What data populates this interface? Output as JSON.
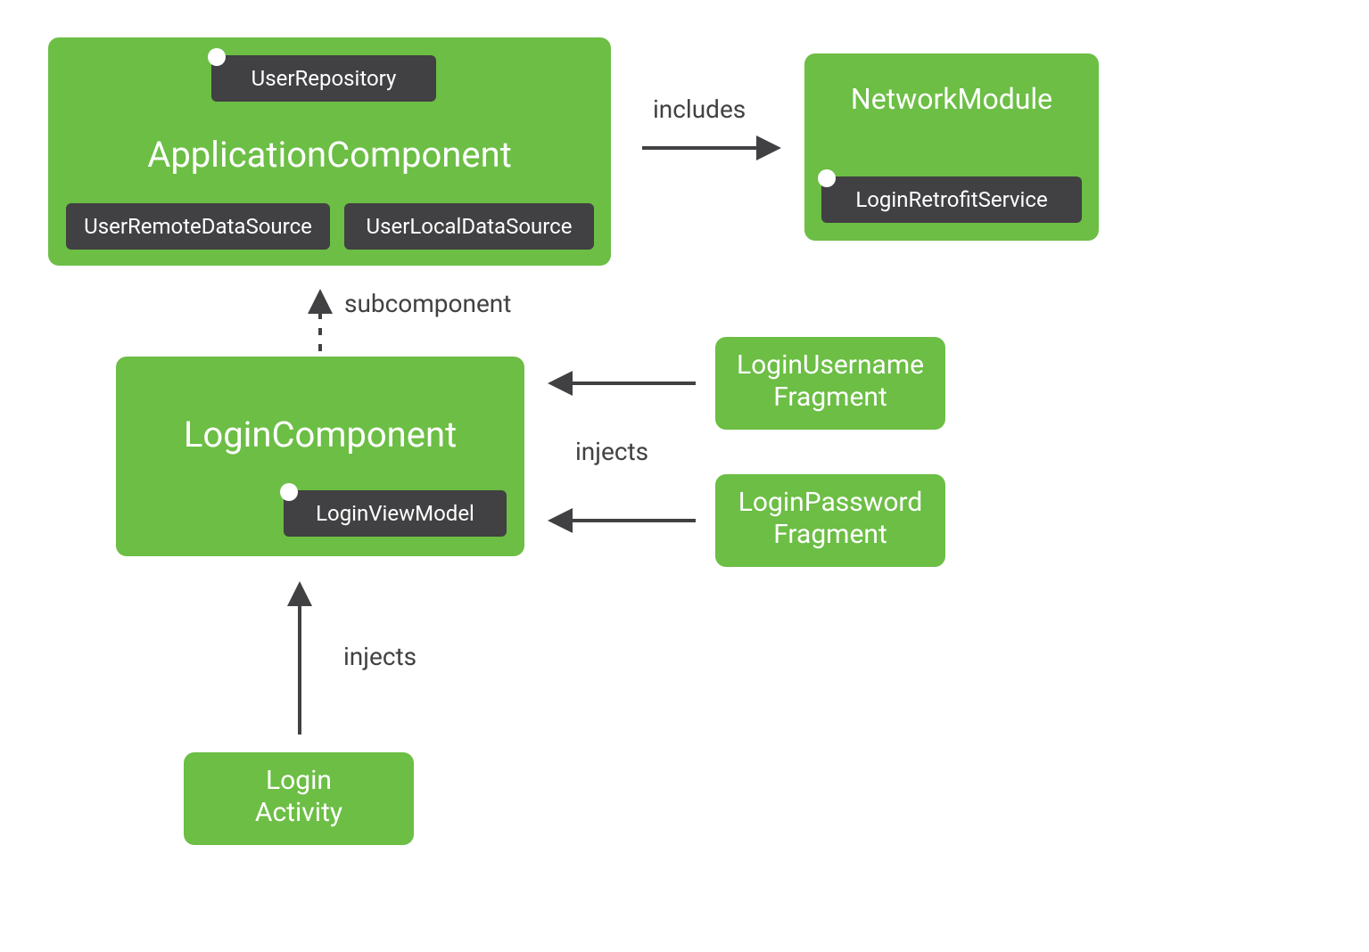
{
  "colors": {
    "box_green": "#6cbe45",
    "chip_dark": "#414042",
    "text_light": "#ffffff",
    "label_gray": "#414042"
  },
  "nodes": {
    "application_component": {
      "title": "ApplicationComponent",
      "chips": {
        "user_repository": "UserRepository",
        "user_remote_ds": "UserRemoteDataSource",
        "user_local_ds": "UserLocalDataSource"
      }
    },
    "network_module": {
      "title": "NetworkModule",
      "chips": {
        "login_retrofit_service": "LoginRetrofitService"
      }
    },
    "login_component": {
      "title": "LoginComponent",
      "chips": {
        "login_view_model": "LoginViewModel"
      }
    },
    "login_username_fragment": {
      "title": "LoginUsername\nFragment"
    },
    "login_password_fragment": {
      "title": "LoginPassword\nFragment"
    },
    "login_activity": {
      "title": "Login\nActivity"
    }
  },
  "edges": {
    "includes": "includes",
    "subcomponent": "subcomponent",
    "injects_top": "injects",
    "injects_bottom": "injects"
  }
}
